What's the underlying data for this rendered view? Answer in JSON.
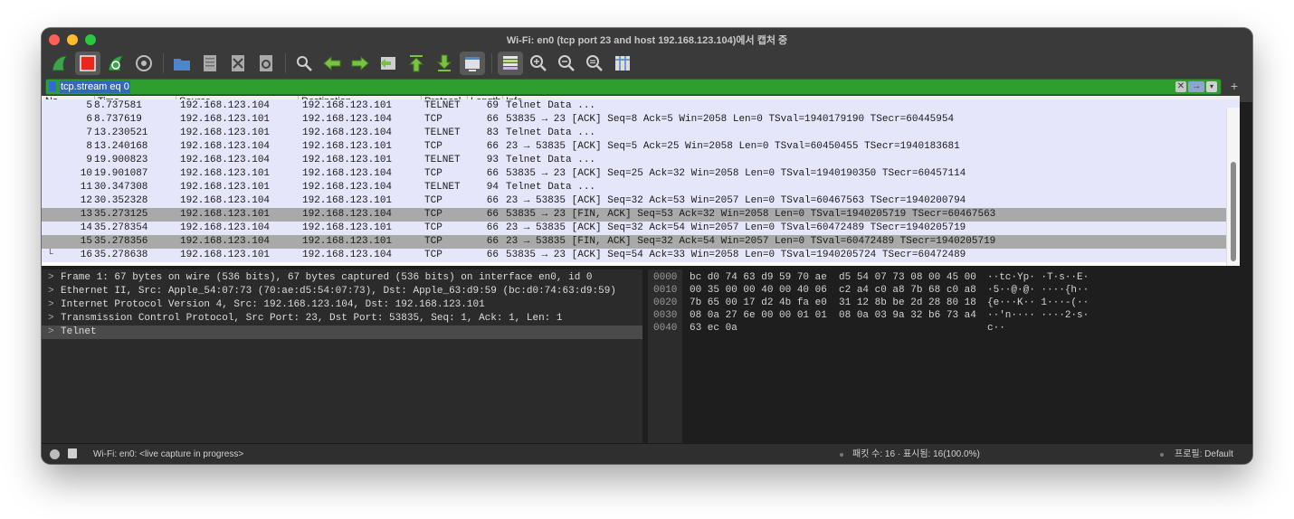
{
  "window": {
    "title": "Wi-Fi: en0 (tcp port 23 and host 192.168.123.104)에서 캡처 중"
  },
  "toolbar": {
    "buttons": [
      "start-capture-icon",
      "stop-capture-icon",
      "restart-capture-icon",
      "capture-options-icon",
      "open-file-icon",
      "save-file-icon",
      "close-file-icon",
      "reload-file-icon",
      "find-packet-icon",
      "go-back-icon",
      "go-forward-icon",
      "go-to-packet-icon",
      "go-first-icon",
      "go-last-icon",
      "autoscroll-icon",
      "colorize-icon",
      "zoom-in-icon",
      "zoom-out-icon",
      "zoom-reset-icon",
      "resize-columns-icon"
    ]
  },
  "filter": {
    "value": "tcp.stream eq 0",
    "clear_label": "✕",
    "apply_label": "→",
    "dropdown_label": "▾",
    "add_label": "+"
  },
  "packet_list": {
    "columns": [
      "No.",
      "Time",
      "Source",
      "Destination",
      "Protocol",
      "Length",
      "Info"
    ],
    "rows": [
      {
        "no": "5",
        "time": "8.737581",
        "src": "192.168.123.104",
        "dst": "192.168.123.101",
        "proto": "TELNET",
        "len": "69",
        "info": "Telnet Data ...",
        "style": "partial"
      },
      {
        "no": "6",
        "time": "8.737619",
        "src": "192.168.123.101",
        "dst": "192.168.123.104",
        "proto": "TCP",
        "len": "66",
        "info": "53835 → 23 [ACK] Seq=8 Ack=5 Win=2058 Len=0 TSval=1940179190 TSecr=60445954",
        "style": ""
      },
      {
        "no": "7",
        "time": "13.230521",
        "src": "192.168.123.101",
        "dst": "192.168.123.104",
        "proto": "TELNET",
        "len": "83",
        "info": "Telnet Data ...",
        "style": ""
      },
      {
        "no": "8",
        "time": "13.240168",
        "src": "192.168.123.104",
        "dst": "192.168.123.101",
        "proto": "TCP",
        "len": "66",
        "info": "23 → 53835 [ACK] Seq=5 Ack=25 Win=2058 Len=0 TSval=60450455 TSecr=1940183681",
        "style": ""
      },
      {
        "no": "9",
        "time": "19.900823",
        "src": "192.168.123.104",
        "dst": "192.168.123.101",
        "proto": "TELNET",
        "len": "93",
        "info": "Telnet Data ...",
        "style": ""
      },
      {
        "no": "10",
        "time": "19.901087",
        "src": "192.168.123.101",
        "dst": "192.168.123.104",
        "proto": "TCP",
        "len": "66",
        "info": "53835 → 23 [ACK] Seq=25 Ack=32 Win=2058 Len=0 TSval=1940190350 TSecr=60457114",
        "style": ""
      },
      {
        "no": "11",
        "time": "30.347308",
        "src": "192.168.123.101",
        "dst": "192.168.123.104",
        "proto": "TELNET",
        "len": "94",
        "info": "Telnet Data ...",
        "style": ""
      },
      {
        "no": "12",
        "time": "30.352328",
        "src": "192.168.123.104",
        "dst": "192.168.123.101",
        "proto": "TCP",
        "len": "66",
        "info": "23 → 53835 [ACK] Seq=32 Ack=53 Win=2057 Len=0 TSval=60467563 TSecr=1940200794",
        "style": ""
      },
      {
        "no": "13",
        "time": "35.273125",
        "src": "192.168.123.101",
        "dst": "192.168.123.104",
        "proto": "TCP",
        "len": "66",
        "info": "53835 → 23 [FIN, ACK] Seq=53 Ack=32 Win=2058 Len=0 TSval=1940205719 TSecr=60467563",
        "style": "gray"
      },
      {
        "no": "14",
        "time": "35.278354",
        "src": "192.168.123.104",
        "dst": "192.168.123.101",
        "proto": "TCP",
        "len": "66",
        "info": "23 → 53835 [ACK] Seq=32 Ack=54 Win=2057 Len=0 TSval=60472489 TSecr=1940205719",
        "style": ""
      },
      {
        "no": "15",
        "time": "35.278356",
        "src": "192.168.123.104",
        "dst": "192.168.123.101",
        "proto": "TCP",
        "len": "66",
        "info": "23 → 53835 [FIN, ACK] Seq=32 Ack=54 Win=2057 Len=0 TSval=60472489 TSecr=1940205719",
        "style": "gray"
      },
      {
        "no": "16",
        "time": "35.278638",
        "src": "192.168.123.101",
        "dst": "192.168.123.104",
        "proto": "TCP",
        "len": "66",
        "info": "53835 → 23 [ACK] Seq=54 Ack=33 Win=2058 Len=0 TSval=1940205724 TSecr=60472489",
        "style": "last"
      }
    ]
  },
  "details": {
    "items": [
      {
        "arrow": ">",
        "text": "Frame 1: 67 bytes on wire (536 bits), 67 bytes captured (536 bits) on interface en0, id 0"
      },
      {
        "arrow": ">",
        "text": "Ethernet II, Src: Apple_54:07:73 (70:ae:d5:54:07:73), Dst: Apple_63:d9:59 (bc:d0:74:63:d9:59)"
      },
      {
        "arrow": ">",
        "text": "Internet Protocol Version 4, Src: 192.168.123.104, Dst: 192.168.123.101"
      },
      {
        "arrow": ">",
        "text": "Transmission Control Protocol, Src Port: 23, Dst Port: 53835, Seq: 1, Ack: 1, Len: 1"
      },
      {
        "arrow": ">",
        "text": "Telnet"
      }
    ]
  },
  "hex": {
    "lines": [
      {
        "offset": "0000",
        "bytes": "bc d0 74 63 d9 59 70 ae  d5 54 07 73 08 00 45 00",
        "ascii": "··tc·Yp· ·T·s··E·"
      },
      {
        "offset": "0010",
        "bytes": "00 35 00 00 40 00 40 06  c2 a4 c0 a8 7b 68 c0 a8",
        "ascii": "·5··@·@· ····{h··"
      },
      {
        "offset": "0020",
        "bytes": "7b 65 00 17 d2 4b fa e0  31 12 8b be 2d 28 80 18",
        "ascii": "{e···K·· 1···-(··"
      },
      {
        "offset": "0030",
        "bytes": "08 0a 27 6e 00 00 01 01  08 0a 03 9a 32 b6 73 a4",
        "ascii": "··'n···· ····2·s·"
      },
      {
        "offset": "0040",
        "bytes": "63 ec 0a",
        "ascii": "c··"
      }
    ]
  },
  "status": {
    "capture": "Wi-Fi: en0: <live capture in progress>",
    "packets": "패킷 수: 16 · 표시됨: 16(100.0%)",
    "profile": "프로필: Default"
  }
}
